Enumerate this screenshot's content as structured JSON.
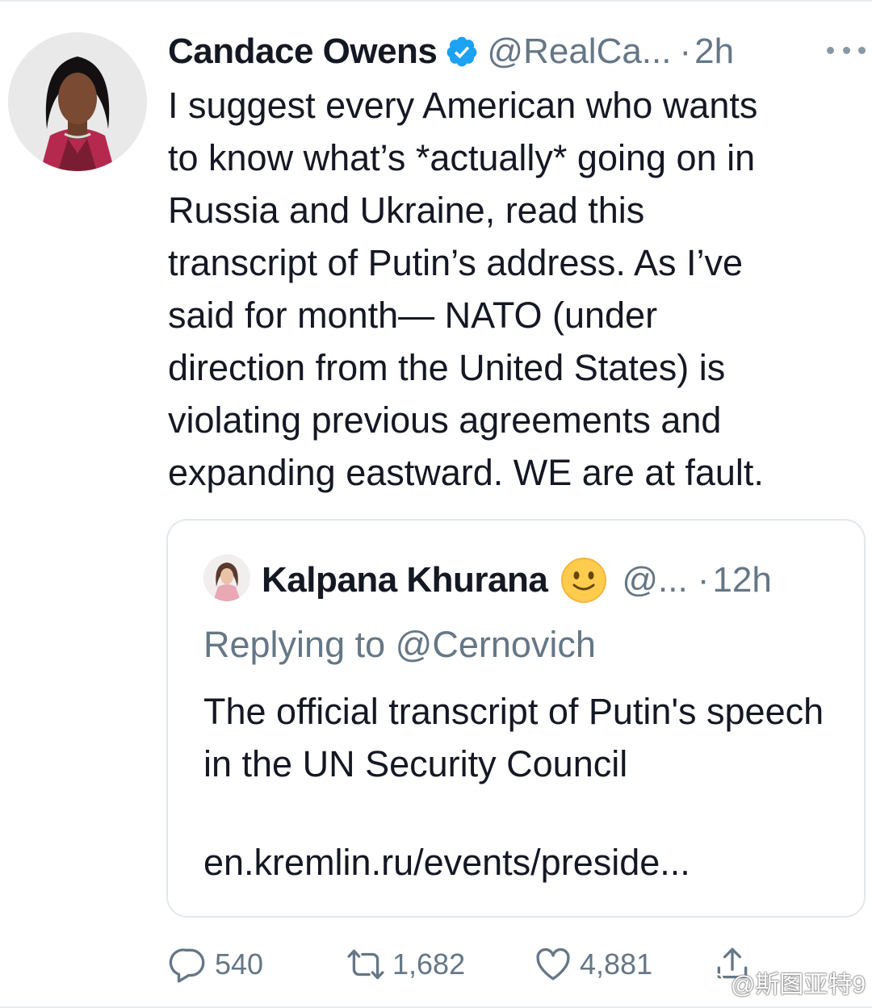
{
  "tweet": {
    "author_name": "Candace Owens",
    "handle": "@RealCa...",
    "separator": "·",
    "time": "2h",
    "text": "I suggest every American who wants\nto know what’s *actually* going on in\nRussia and Ukraine, read this\ntranscript of Putin’s address. As I’ve\nsaid for month— NATO (under\ndirection from the United States) is\nviolating previous agreements and\nexpanding eastward. WE are at fault."
  },
  "quoted_tweet": {
    "author_name": "Kalpana Khurana",
    "emoji": "🙂",
    "handle": "@...",
    "separator": "·",
    "time": "12h",
    "replying_to": "Replying to @Cernovich",
    "text": "The official transcript of Putin's speech in the UN Security Council",
    "link": "en.kremlin.ru/events/preside..."
  },
  "actions": {
    "reply_count": "540",
    "retweet_count": "1,682",
    "like_count": "4,881"
  },
  "watermark": "@斯图亚特9",
  "colors": {
    "text": "#141823",
    "secondary": "#657786",
    "verified": "#1da1f2",
    "border": "#e1e8ed"
  },
  "icons": [
    "verified-badge-icon",
    "more-options-icon",
    "reply-icon",
    "retweet-icon",
    "like-icon",
    "share-icon",
    "weibo-logo-icon"
  ]
}
